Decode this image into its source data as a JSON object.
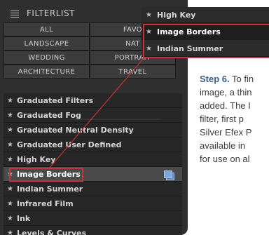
{
  "header": {
    "title": "FILTERLIST",
    "menu_icon": "list-icon"
  },
  "categories": [
    {
      "label": "ALL"
    },
    {
      "label": "FAVO"
    },
    {
      "label": "LANDSCAPE"
    },
    {
      "label": "NAT"
    },
    {
      "label": "WEDDING"
    },
    {
      "label": "PORTRAIT"
    },
    {
      "label": "ARCHITECTURE"
    },
    {
      "label": "TRAVEL"
    }
  ],
  "filters": [
    {
      "label": "Graduated Filters"
    },
    {
      "label": "Graduated Fog"
    },
    {
      "label": "Graduated Neutral Density"
    },
    {
      "label": "Graduated User Defined"
    },
    {
      "label": "High Key"
    },
    {
      "label": "Image Borders",
      "selected": true
    },
    {
      "label": "Indian Summer"
    },
    {
      "label": "Infrared Film"
    },
    {
      "label": "Ink"
    },
    {
      "label": "Levels & Curves"
    }
  ],
  "favorites_popup": [
    {
      "label": "High Key"
    },
    {
      "label": "Image Borders",
      "selected": true
    },
    {
      "label": "Indian Summer"
    }
  ],
  "caption": {
    "step": "Step 6.",
    "lines": [
      " To fin",
      "image, a thin",
      "added. The I",
      "filter, first  p",
      "Silver Efex P",
      "available in",
      "for use on al"
    ]
  },
  "colors": {
    "highlight": "#c4343a",
    "panel": "#2f2f2f",
    "step": "#3d5f86"
  }
}
